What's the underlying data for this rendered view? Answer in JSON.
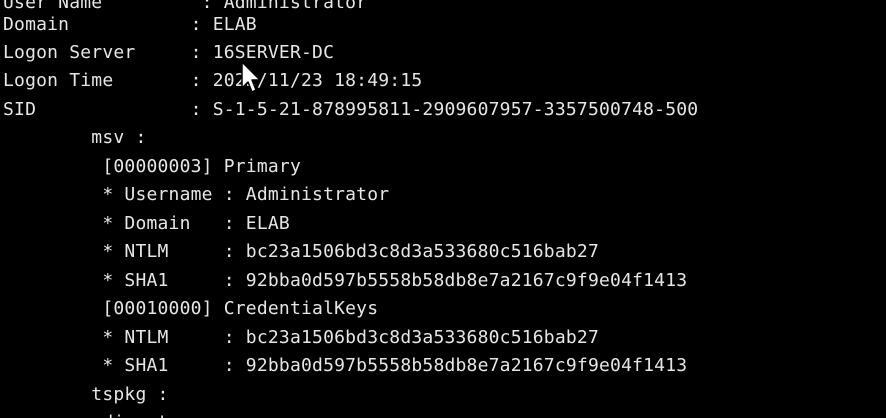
{
  "colors": {
    "background": "#000000",
    "text": "#e6e6e6",
    "cursor_fill": "#ffffff",
    "cursor_stroke": "#000000"
  },
  "cursor_icon": "mouse-pointer-icon",
  "lines": [
    "User Name         : Administrator",
    "Domain           : ELAB",
    "Logon Server     : 16SERVER-DC",
    "Logon Time       : 2022/11/23 18:49:15",
    "SID              : S-1-5-21-878995811-2909607957-3357500748-500",
    "        msv :",
    "         [00000003] Primary",
    "         * Username : Administrator",
    "         * Domain   : ELAB",
    "         * NTLM     : bc23a1506bd3c8d3a533680c516bab27",
    "         * SHA1     : 92bba0d597b5558b58db8e7a2167c9f9e04f1413",
    "         [00010000] CredentialKeys",
    "         * NTLM     : bc23a1506bd3c8d3a533680c516bab27",
    "         * SHA1     : 92bba0d597b5558b58db8e7a2167c9f9e04f1413",
    "        tspkg :",
    "        wdigest :"
  ]
}
